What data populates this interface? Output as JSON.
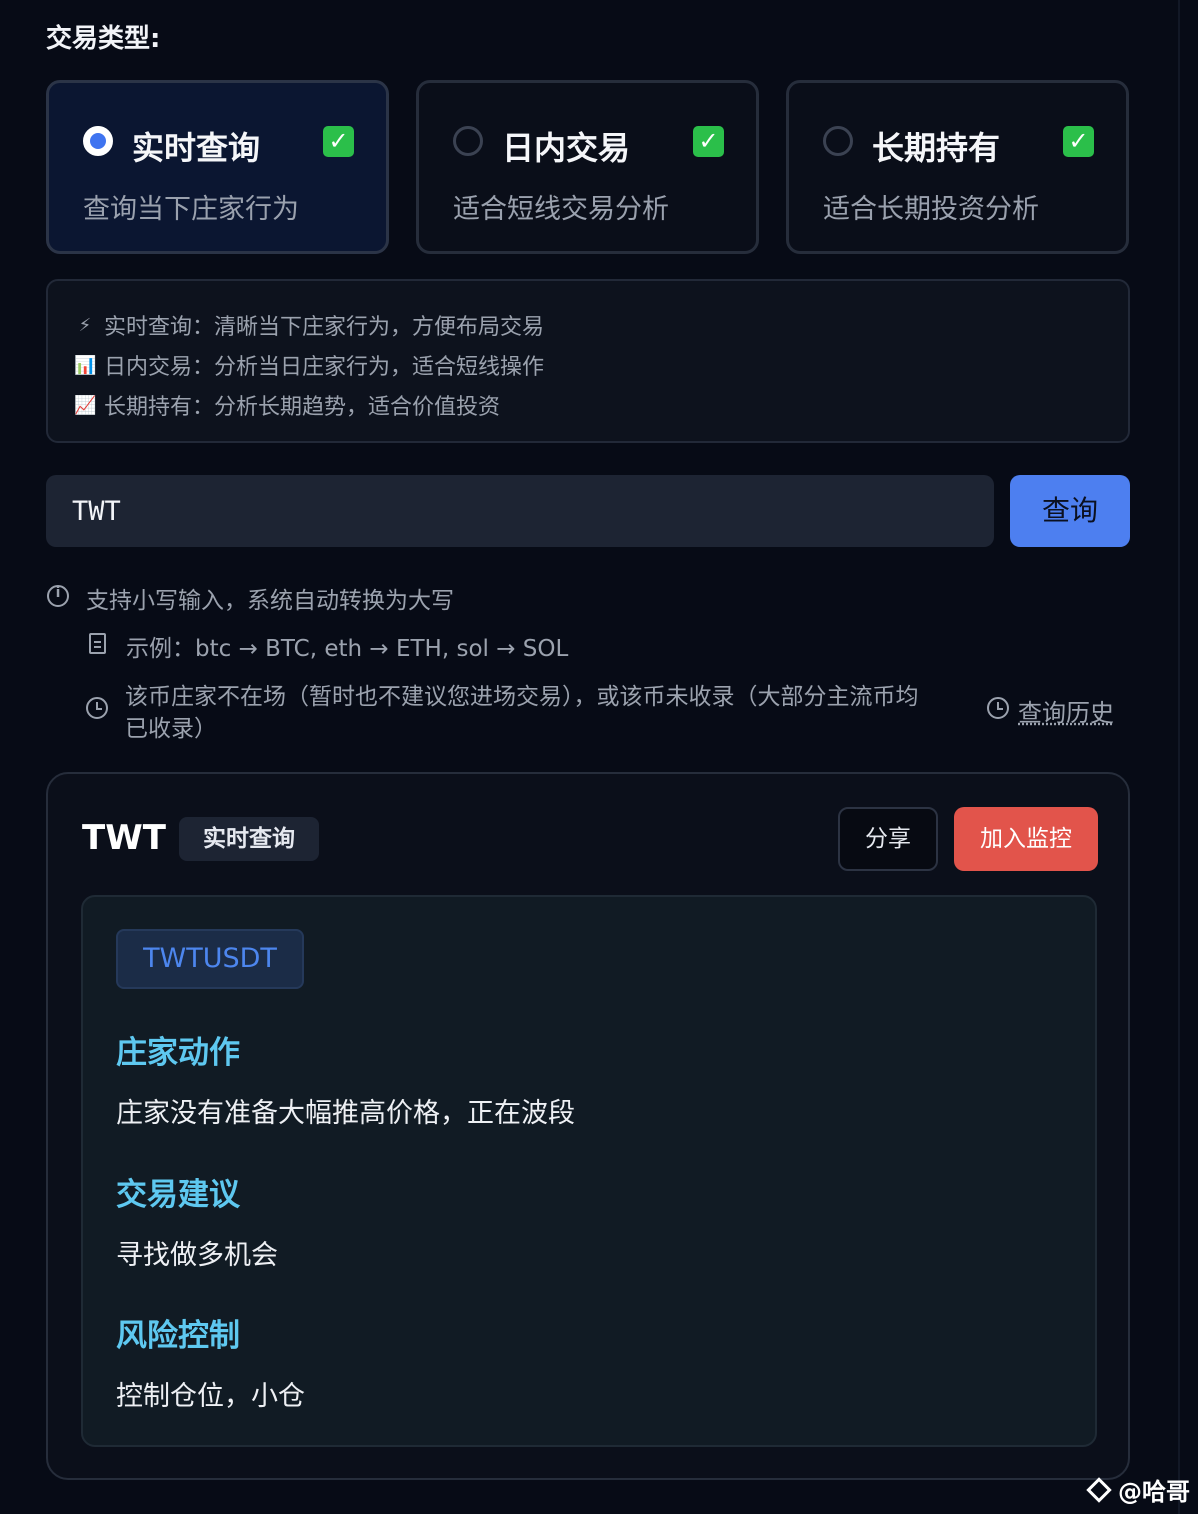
{
  "section_title": "交易类型:",
  "trade_types": [
    {
      "title": "实时查询",
      "desc": "查询当下庄家行为",
      "selected": true,
      "check": "✓"
    },
    {
      "title": "日内交易",
      "desc": "适合短线交易分析",
      "selected": false,
      "check": "✓"
    },
    {
      "title": "长期持有",
      "desc": "适合长期投资分析",
      "selected": false,
      "check": "✓"
    }
  ],
  "info_lines": [
    {
      "icon": "⚡",
      "text": "实时查询：清晰当下庄家行为，方便布局交易"
    },
    {
      "icon": "📊",
      "text": "日内交易：分析当日庄家行为，适合短线操作"
    },
    {
      "icon": "📈",
      "text": "长期持有：分析长期趋势，适合价值投资"
    }
  ],
  "search": {
    "value": "TWT",
    "button_label": "查询"
  },
  "hints": {
    "uppercase": "支持小写输入，系统自动转换为大写",
    "example": "示例：btc → BTC, eth → ETH, sol → SOL",
    "not_listed_line1": "该币庄家不在场（暂时也不建议您进场交易），或该币未收录（大部分主流币均",
    "not_listed_line2": "已收录）",
    "history_link": "查询历史"
  },
  "result": {
    "symbol": "TWT",
    "mode": "实时查询",
    "share_label": "分享",
    "monitor_label": "加入监控",
    "pair": "TWTUSDT",
    "sections": [
      {
        "heading": "庄家动作",
        "text": "庄家没有准备大幅推高价格，正在波段"
      },
      {
        "heading": "交易建议",
        "text": "寻找做多机会"
      },
      {
        "heading": "风险控制",
        "text": "控制仓位，小仓"
      }
    ]
  },
  "watermark": "@哈哥",
  "colors": {
    "background": "#070b16",
    "accent_blue": "#4d7ff0",
    "danger_red": "#e2544b",
    "heading_cyan": "#5ec8f0",
    "check_green": "#2bbf4a"
  }
}
